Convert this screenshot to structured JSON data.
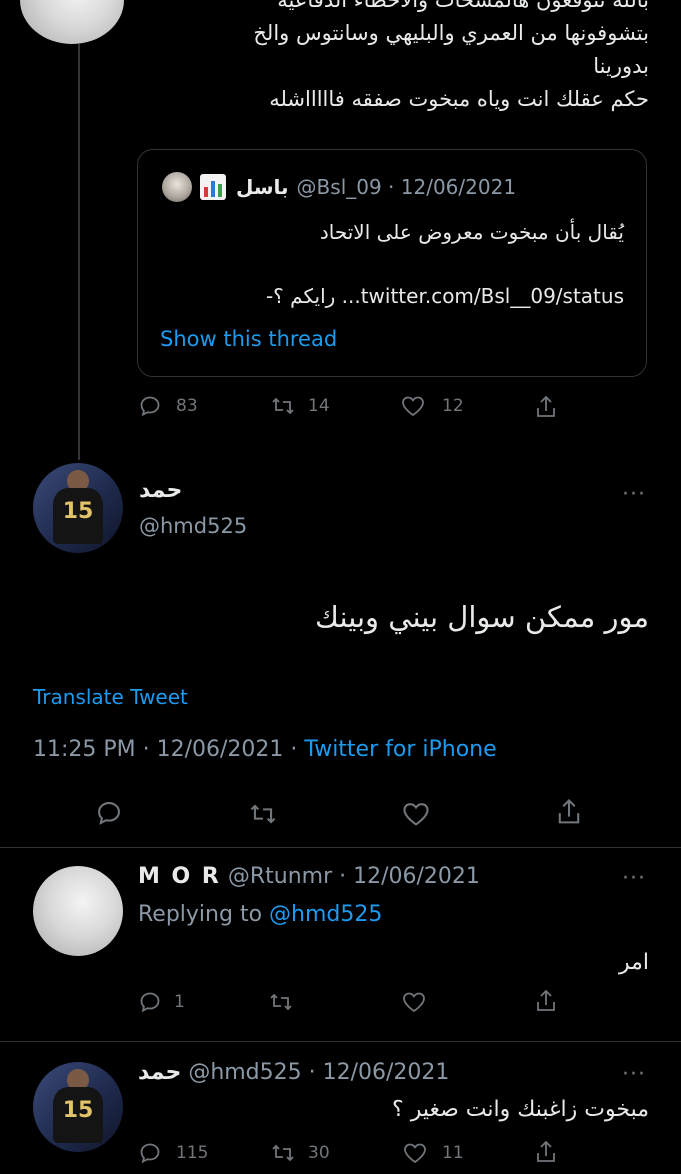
{
  "top_tweet": {
    "lines": [
      "بالله تتوقعون هالمسحات والاخطاء الدفاعيه",
      "بتشوفونها من العمري والبليهي وسانتوس والخ",
      "بدورينا",
      "حكم عقلك انت وياه مبخوت صفقه فاااااشله"
    ],
    "quote": {
      "name": "باسل",
      "handle_date": "@Bsl_09 · 12/06/2021",
      "text": "يُقال بأن مبخوت معروض على الاتحاد",
      "link_line": "-رايكم ؟ ...twitter.com/Bsl__09/status",
      "show_thread": "Show this thread"
    },
    "actions": {
      "replies": "83",
      "retweets": "14",
      "likes": "12"
    }
  },
  "main_tweet": {
    "name": "حمد",
    "handle": "@hmd525",
    "text": "مور ممكن سوال بيني وبينك",
    "translate": "Translate Tweet",
    "time_date": "11:25 PM · 12/06/2021 · ",
    "source": "Twitter for iPhone",
    "more": "···"
  },
  "reply1": {
    "name": "M O R",
    "handle_date": "@Rtunmr · 12/06/2021",
    "replying_prefix": "Replying to ",
    "replying_handle": "@hmd525",
    "text": "امر",
    "actions": {
      "replies": "1"
    },
    "more": "···"
  },
  "reply2": {
    "name": "حمد",
    "handle_date": "@hmd525 · 12/06/2021",
    "text": "مبخوت زاغبنك وانت صغير ؟",
    "actions": {
      "replies": "115",
      "retweets": "30",
      "likes": "11"
    },
    "more": "···"
  },
  "avatar_number": "15",
  "colors": {
    "background": "#000000",
    "text": "#e7e9ea",
    "muted": "#8b98a5",
    "link": "#1d9bf0",
    "divider": "#2f3336"
  }
}
